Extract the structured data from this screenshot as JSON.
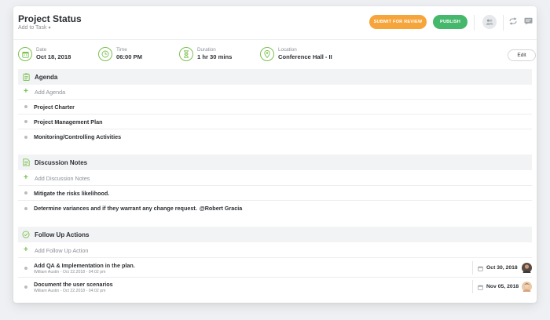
{
  "header": {
    "title": "Project Status",
    "subtitle": "Add to Task",
    "review_label": "SUBMIT FOR REVIEW",
    "publish_label": "PUBLISH"
  },
  "meta": {
    "date_label": "Date",
    "date_value": "Oct 18, 2018",
    "time_label": "Time",
    "time_value": "06:00 PM",
    "duration_label": "Duration",
    "duration_value": "1 hr 30 mins",
    "location_label": "Location",
    "location_value": "Conference Hall - II",
    "edit_label": "Edit"
  },
  "agenda": {
    "title": "Agenda",
    "add_label": "Add Agenda",
    "items": [
      "Project Charter",
      "Project Management Plan",
      "Monitoring/Controlling Activities"
    ]
  },
  "notes": {
    "title": "Discussion Notes",
    "add_label": "Add Discussion Notes",
    "items": [
      "Mitigate the risks likelihood.",
      "Determine variances and if they warrant any change request."
    ],
    "mention": "@Robert Gracia"
  },
  "actions": {
    "title": "Follow Up Actions",
    "add_label": "Add Follow Up Action",
    "items": [
      {
        "title": "Add QA & Implementation in the plan.",
        "meta": "William Austin - Oct 22.2018 - 04:02 pm",
        "due": "Oct 30, 2018"
      },
      {
        "title": "Document the user scenarios",
        "meta": "William Austin - Oct 22.2018 - 04:02 pm",
        "due": "Nov 05, 2018"
      }
    ]
  },
  "colors": {
    "accent_green": "#7cc04f",
    "review_orange": "#f6a53b",
    "publish_green": "#45b86b"
  },
  "icons": [
    "users-icon",
    "share-icon",
    "message-icon",
    "calendar-icon",
    "clock-icon",
    "hourglass-icon",
    "location-pin-icon",
    "clipboard-icon",
    "notes-icon",
    "check-circle-icon",
    "plus-icon"
  ]
}
